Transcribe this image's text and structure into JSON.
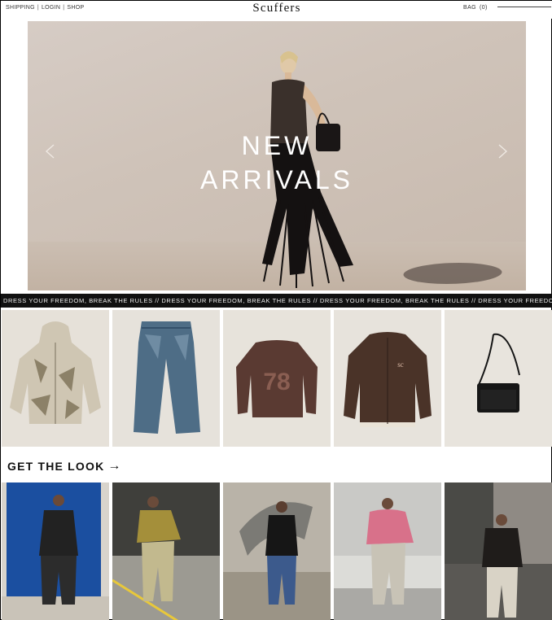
{
  "header": {
    "links": [
      "SHIPPING",
      "LOGIN",
      "SHOP"
    ],
    "separator": "|",
    "logo": "Scuffers",
    "bag_label": "BAG",
    "bag_count": "(0)"
  },
  "hero": {
    "title_line1": "NEW",
    "title_line2": "ARRIVALS",
    "prev_icon": "chevron-left-icon",
    "next_icon": "chevron-right-icon"
  },
  "ticker": {
    "text": "DRESS YOUR FREEDOM, BREAK THE RULES // DRESS YOUR FREEDOM, BREAK THE RULES // DRESS YOUR FREEDOM, BREAK THE RULES // DRESS YOUR FREEDOM, BREAK THE RULES // DRESS YOUR FREEDOM, BRE"
  },
  "products": [
    {
      "name": "camo-hoodie"
    },
    {
      "name": "denim-jeans"
    },
    {
      "name": "sweater-78"
    },
    {
      "name": "leather-varsity-jacket"
    },
    {
      "name": "crossbody-bag"
    }
  ],
  "get_the_look": {
    "label": "GET THE LOOK",
    "arrow": "→"
  },
  "looks": [
    {
      "name": "look-blue-door"
    },
    {
      "name": "look-yellow-sweater"
    },
    {
      "name": "look-sculpture"
    },
    {
      "name": "look-pink-hoodie"
    },
    {
      "name": "look-leather-jacket"
    }
  ],
  "colors": {
    "ticker_bg": "#111111",
    "product_bg": "#e8e4dd",
    "hero_wall": "#cfc3b9"
  }
}
